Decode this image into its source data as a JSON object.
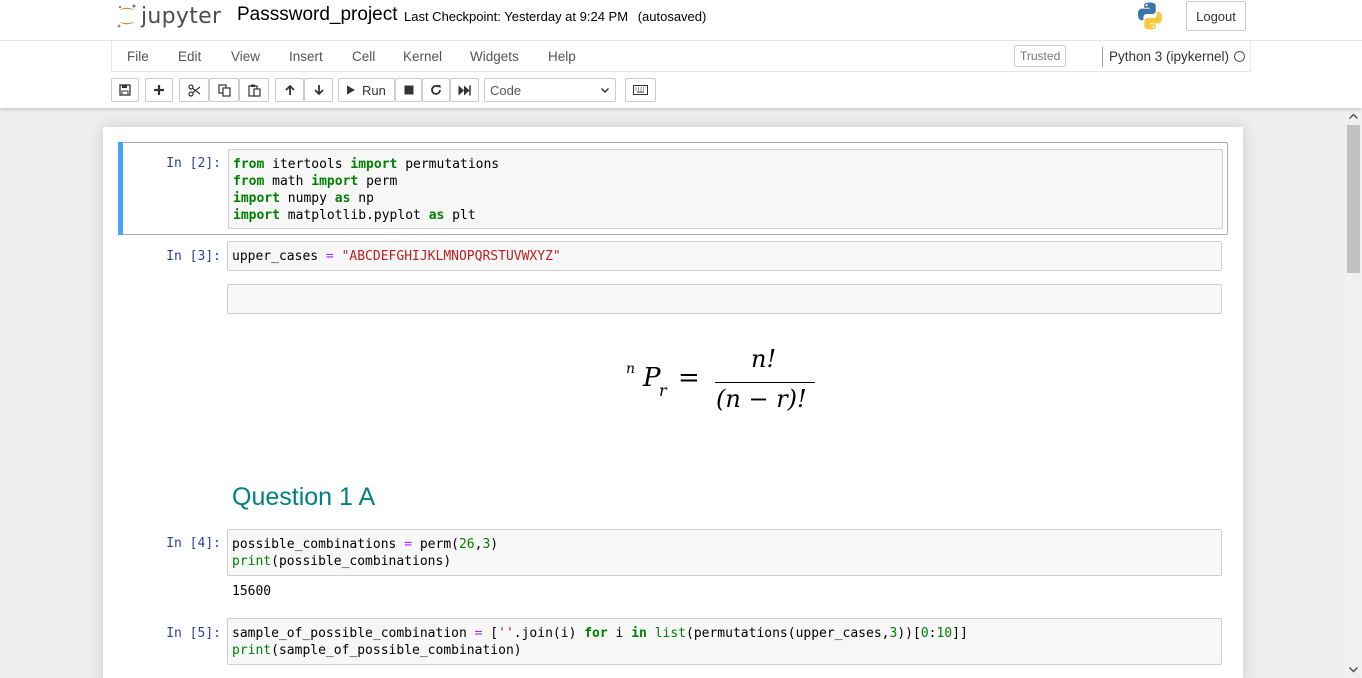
{
  "header": {
    "logo_text": "jupyter",
    "notebook_name": "Passsword_project",
    "checkpoint_label": "Last Checkpoint:",
    "checkpoint_time": "Yesterday at 9:24 PM",
    "autosave_status": "(autosaved)",
    "logout_label": "Logout"
  },
  "menubar": {
    "items": [
      "File",
      "Edit",
      "View",
      "Insert",
      "Cell",
      "Kernel",
      "Widgets",
      "Help"
    ],
    "trusted_label": "Trusted",
    "kernel_name": "Python 3 (ipykernel)"
  },
  "toolbar": {
    "run_label": "Run",
    "cell_type": "Code"
  },
  "cells": [
    {
      "prompt": "In [2]:",
      "lines": [
        "from itertools import permutations",
        "from math import perm",
        "import numpy as np",
        "import matplotlib.pyplot as plt"
      ]
    },
    {
      "prompt": "In [3]:",
      "lines": [
        "upper_cases = \"ABCDEFGHIJKLMNOPQRSTUVWXYZ\""
      ]
    },
    {
      "prompt": "In [4]:",
      "lines": [
        "possible_combinations = perm(26,3)",
        "print(possible_combinations)"
      ],
      "output": "15600"
    },
    {
      "prompt": "In [5]:",
      "lines": [
        "sample_of_possible_combination = [''.join(i) for i in list(permutations(upper_cases,3))[0:10]]",
        "print(sample_of_possible_combination)"
      ]
    }
  ],
  "markdown": {
    "formula_n": "n",
    "formula_P": "P",
    "formula_r": "r",
    "formula_eq": "=",
    "formula_num": "n!",
    "formula_den": "(n − r)!",
    "heading": "Question 1 A"
  },
  "colors": {
    "accent": "#42a5f5",
    "prompt": "#303f9f",
    "heading": "#00807f",
    "keyword": "#008000",
    "string": "#ba2121",
    "operator": "#aa22ff"
  }
}
